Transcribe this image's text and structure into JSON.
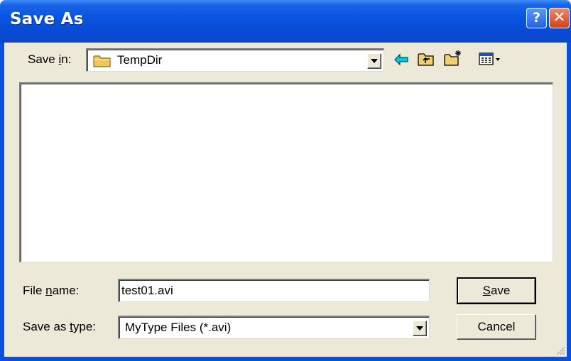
{
  "window": {
    "title": "Save As",
    "help_glyph": "?",
    "close_glyph": "✕"
  },
  "save_in": {
    "label_prefix": "Save ",
    "label_mnemonic": "i",
    "label_suffix": "n:",
    "folder_icon": "folder-icon",
    "value": "TempDir"
  },
  "toolbar": {
    "icons": [
      "back-arrow-icon",
      "up-folder-icon",
      "new-folder-icon",
      "view-menu-icon"
    ]
  },
  "file_name": {
    "label_prefix": "File ",
    "label_mnemonic": "n",
    "label_suffix": "ame:",
    "value": "test01.avi"
  },
  "save_as_type": {
    "label_prefix": "Save as ",
    "label_mnemonic": "t",
    "label_suffix": "ype:",
    "value": "MyType Files (*.avi)"
  },
  "buttons": {
    "save_mnemonic": "S",
    "save_rest": "ave",
    "cancel": "Cancel"
  },
  "colors": {
    "titlebar": "#0a55e0",
    "dialog_face": "#ece9d8",
    "close_button": "#d2421a",
    "folder": "#f0c860",
    "back_arrow": "#00c8d8"
  }
}
